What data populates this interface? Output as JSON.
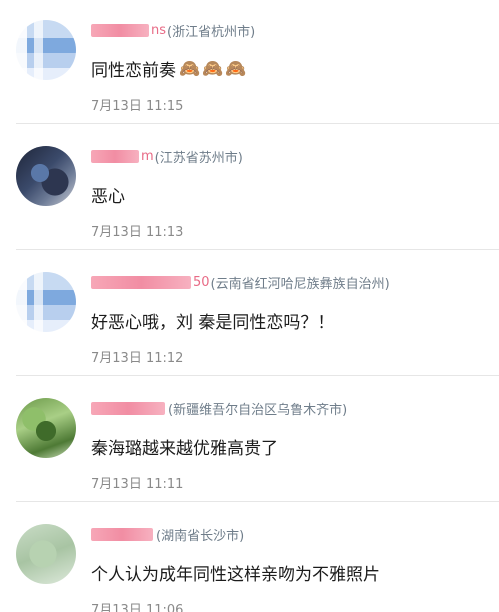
{
  "comments": [
    {
      "name_visible": "ns",
      "location": "(浙江省杭州市)",
      "text": "同性恋前奏",
      "emoji": [
        "🙈",
        "🙈",
        "🙈"
      ],
      "time": "7月13日 11:15"
    },
    {
      "name_visible": "m",
      "location": "(江苏省苏州市)",
      "text": "恶心",
      "emoji": [],
      "time": "7月13日 11:13"
    },
    {
      "name_visible": "50",
      "location": "(云南省红河哈尼族彝族自治州)",
      "text": "好恶心哦，刘 秦是同性恋吗？！",
      "emoji": [],
      "time": "7月13日 11:12"
    },
    {
      "name_visible": "",
      "location": "(新疆维吾尔自治区乌鲁木齐市)",
      "text": "秦海璐越来越优雅高贵了",
      "emoji": [],
      "time": "7月13日 11:11"
    },
    {
      "name_visible": "",
      "location": "(湖南省长沙市)",
      "text": "个人认为成年同性这样亲吻为不雅照片",
      "emoji": [],
      "time": "7月13日 11:06"
    }
  ]
}
